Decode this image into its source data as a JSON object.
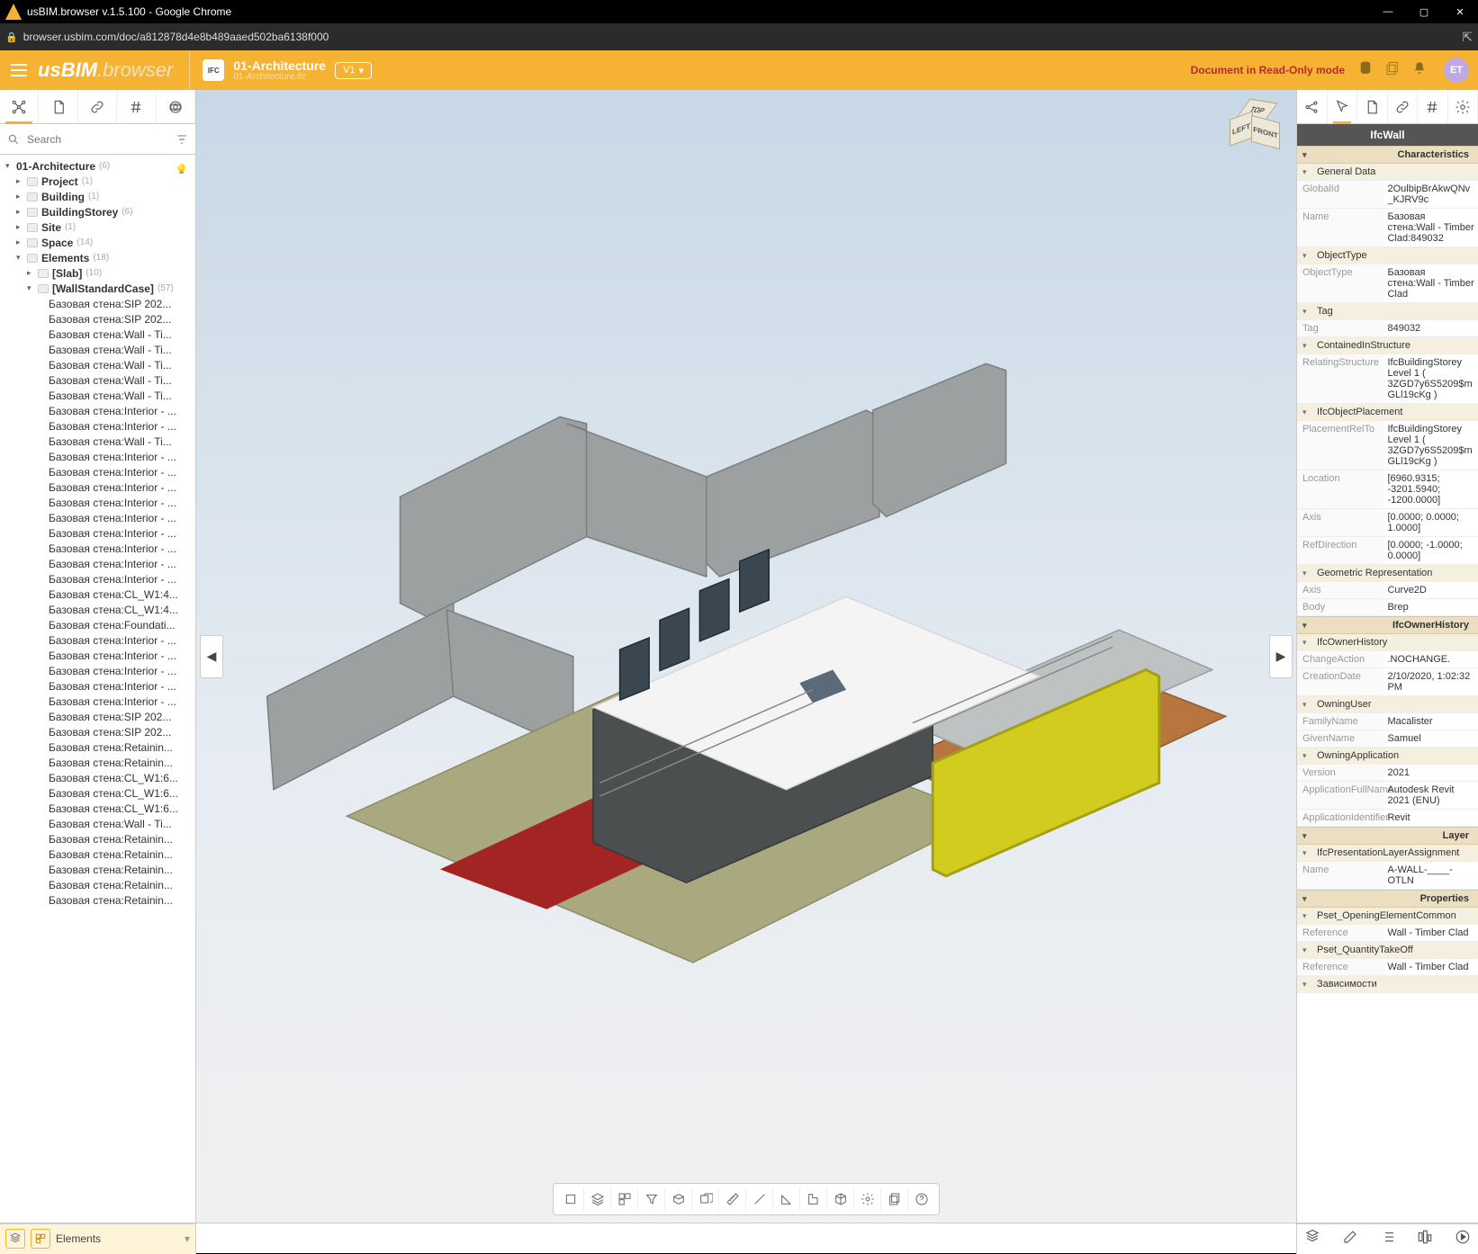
{
  "window": {
    "title": "usBIM.browser v.1.5.100 - Google Chrome",
    "url": "browser.usbim.com/doc/a812878d4e8b489aaed502ba6138f000"
  },
  "brand": {
    "us": "us",
    "bim": "BIM",
    "browser": ".browser"
  },
  "doc": {
    "title": "01-Architecture",
    "file": "01-Architecture.ifc",
    "version": "V1",
    "readonly": "Document in Read-Only mode",
    "avatar": "ET"
  },
  "search": {
    "placeholder": "Search"
  },
  "left_tabs": [
    {
      "name": "structure",
      "active": true
    },
    {
      "name": "documents",
      "active": false
    },
    {
      "name": "links",
      "active": false
    },
    {
      "name": "hash",
      "active": false
    },
    {
      "name": "render",
      "active": false
    }
  ],
  "right_tabs": [
    {
      "name": "share",
      "active": false
    },
    {
      "name": "select",
      "active": true
    },
    {
      "name": "documents",
      "active": false
    },
    {
      "name": "links",
      "active": false
    },
    {
      "name": "hash",
      "active": false
    },
    {
      "name": "settings",
      "active": false
    }
  ],
  "tree": [
    {
      "d": 0,
      "exp": true,
      "fold": false,
      "label": "01-Architecture",
      "count": "(6)",
      "bold": true,
      "bulb": true
    },
    {
      "d": 1,
      "exp": false,
      "fold": true,
      "label": "Project",
      "count": "(1)",
      "bold": true
    },
    {
      "d": 1,
      "exp": false,
      "fold": true,
      "label": "Building",
      "count": "(1)",
      "bold": true
    },
    {
      "d": 1,
      "exp": false,
      "fold": true,
      "label": "BuildingStorey",
      "count": "(6)",
      "bold": true
    },
    {
      "d": 1,
      "exp": false,
      "fold": true,
      "label": "Site",
      "count": "(1)",
      "bold": true
    },
    {
      "d": 1,
      "exp": false,
      "fold": true,
      "label": "Space",
      "count": "(14)",
      "bold": true
    },
    {
      "d": 1,
      "exp": true,
      "fold": true,
      "label": "Elements",
      "count": "(18)",
      "bold": true
    },
    {
      "d": 2,
      "exp": false,
      "fold": true,
      "label": "[Slab]",
      "count": "(10)",
      "bold": true
    },
    {
      "d": 2,
      "exp": true,
      "fold": true,
      "label": "[WallStandardCase]",
      "count": "(57)",
      "bold": true
    },
    {
      "d": 3,
      "label": "Базовая стена:SIP 202..."
    },
    {
      "d": 3,
      "label": "Базовая стена:SIP 202..."
    },
    {
      "d": 3,
      "label": "Базовая стена:Wall - Ti..."
    },
    {
      "d": 3,
      "label": "Базовая стена:Wall - Ti..."
    },
    {
      "d": 3,
      "label": "Базовая стена:Wall - Ti..."
    },
    {
      "d": 3,
      "label": "Базовая стена:Wall - Ti..."
    },
    {
      "d": 3,
      "label": "Базовая стена:Wall - Ti..."
    },
    {
      "d": 3,
      "label": "Базовая стена:Interior - ..."
    },
    {
      "d": 3,
      "label": "Базовая стена:Interior - ..."
    },
    {
      "d": 3,
      "label": "Базовая стена:Wall - Ti..."
    },
    {
      "d": 3,
      "label": "Базовая стена:Interior - ..."
    },
    {
      "d": 3,
      "label": "Базовая стена:Interior - ..."
    },
    {
      "d": 3,
      "label": "Базовая стена:Interior - ..."
    },
    {
      "d": 3,
      "label": "Базовая стена:Interior - ..."
    },
    {
      "d": 3,
      "label": "Базовая стена:Interior - ..."
    },
    {
      "d": 3,
      "label": "Базовая стена:Interior - ..."
    },
    {
      "d": 3,
      "label": "Базовая стена:Interior - ..."
    },
    {
      "d": 3,
      "label": "Базовая стена:Interior - ..."
    },
    {
      "d": 3,
      "label": "Базовая стена:Interior - ..."
    },
    {
      "d": 3,
      "label": "Базовая стена:CL_W1:4..."
    },
    {
      "d": 3,
      "label": "Базовая стена:CL_W1:4..."
    },
    {
      "d": 3,
      "label": "Базовая стена:Foundati..."
    },
    {
      "d": 3,
      "label": "Базовая стена:Interior - ..."
    },
    {
      "d": 3,
      "label": "Базовая стена:Interior - ..."
    },
    {
      "d": 3,
      "label": "Базовая стена:Interior - ..."
    },
    {
      "d": 3,
      "label": "Базовая стена:Interior - ..."
    },
    {
      "d": 3,
      "label": "Базовая стена:Interior - ..."
    },
    {
      "d": 3,
      "label": "Базовая стена:SIP 202..."
    },
    {
      "d": 3,
      "label": "Базовая стена:SIP 202..."
    },
    {
      "d": 3,
      "label": "Базовая стена:Retainin..."
    },
    {
      "d": 3,
      "label": "Базовая стена:Retainin..."
    },
    {
      "d": 3,
      "label": "Базовая стена:CL_W1:6..."
    },
    {
      "d": 3,
      "label": "Базовая стена:CL_W1:6..."
    },
    {
      "d": 3,
      "label": "Базовая стена:CL_W1:6..."
    },
    {
      "d": 3,
      "label": "Базовая стена:Wall - Ti..."
    },
    {
      "d": 3,
      "label": "Базовая стена:Retainin..."
    },
    {
      "d": 3,
      "label": "Базовая стена:Retainin..."
    },
    {
      "d": 3,
      "label": "Базовая стена:Retainin..."
    },
    {
      "d": 3,
      "label": "Базовая стена:Retainin..."
    },
    {
      "d": 3,
      "label": "Базовая стена:Retainin..."
    }
  ],
  "left_bottom": {
    "label": "Elements"
  },
  "viewcube": {
    "top": "TOP",
    "front": "FRONT",
    "left": "LEFT"
  },
  "selected_title": "IfcWall",
  "properties": [
    {
      "type": "bigsec",
      "label": "Characteristics"
    },
    {
      "type": "grp",
      "label": "General Data"
    },
    {
      "type": "kv",
      "k": "GlobalId",
      "v": "2OulbipBrAkwQNv_KJRV9c"
    },
    {
      "type": "kv",
      "k": "Name",
      "v": "Базовая стена:Wall - Timber Clad:849032"
    },
    {
      "type": "grp",
      "label": "ObjectType"
    },
    {
      "type": "kv",
      "k": "ObjectType",
      "v": "Базовая стена:Wall - Timber Clad"
    },
    {
      "type": "grp",
      "label": "Tag"
    },
    {
      "type": "kv",
      "k": "Tag",
      "v": "849032"
    },
    {
      "type": "grp",
      "label": "ContainedInStructure"
    },
    {
      "type": "kv",
      "k": "RelatingStructure",
      "v": "IfcBuildingStorey Level 1 ( 3ZGD7y6S5209$mGLl19cKg )"
    },
    {
      "type": "grp",
      "label": "IfcObjectPlacement"
    },
    {
      "type": "kv",
      "k": "PlacementRelTo",
      "v": "IfcBuildingStorey Level 1 ( 3ZGD7y6S5209$mGLl19cKg )"
    },
    {
      "type": "kv",
      "k": "Location",
      "v": "[6960.9315; -3201.5940; -1200.0000]"
    },
    {
      "type": "kv",
      "k": "Axis",
      "v": "[0.0000; 0.0000; 1.0000]"
    },
    {
      "type": "kv",
      "k": "RefDirection",
      "v": "[0.0000; -1.0000; 0.0000]"
    },
    {
      "type": "grp",
      "label": "Geometric Representation"
    },
    {
      "type": "kv",
      "k": "Axis",
      "v": "Curve2D"
    },
    {
      "type": "kv",
      "k": "Body",
      "v": "Brep"
    },
    {
      "type": "bigsec",
      "label": "IfcOwnerHistory"
    },
    {
      "type": "grp",
      "label": "IfcOwnerHistory"
    },
    {
      "type": "kv",
      "k": "ChangeAction",
      "v": ".NOCHANGE."
    },
    {
      "type": "kv",
      "k": "CreationDate",
      "v": "2/10/2020, 1:02:32 PM"
    },
    {
      "type": "grp",
      "label": "OwningUser"
    },
    {
      "type": "kv",
      "k": "FamilyName",
      "v": "Macalister"
    },
    {
      "type": "kv",
      "k": "GivenName",
      "v": "Samuel"
    },
    {
      "type": "grp",
      "label": "OwningApplication"
    },
    {
      "type": "kv",
      "k": "Version",
      "v": "2021"
    },
    {
      "type": "kv",
      "k": "ApplicationFullName",
      "v": "Autodesk Revit 2021 (ENU)"
    },
    {
      "type": "kv",
      "k": "ApplicationIdentifier",
      "v": "Revit"
    },
    {
      "type": "bigsec",
      "label": "Layer"
    },
    {
      "type": "grp",
      "label": "IfcPresentationLayerAssignment"
    },
    {
      "type": "kv",
      "k": "Name",
      "v": "A-WALL-____-OTLN"
    },
    {
      "type": "bigsec",
      "label": "Properties"
    },
    {
      "type": "grp",
      "label": "Pset_OpeningElementCommon"
    },
    {
      "type": "kv",
      "k": "Reference",
      "v": "Wall - Timber Clad"
    },
    {
      "type": "grp",
      "label": "Pset_QuantityTakeOff"
    },
    {
      "type": "kv",
      "k": "Reference",
      "v": "Wall - Timber Clad"
    },
    {
      "type": "grp",
      "label": "Зависимости"
    }
  ],
  "bottom_toolbar": [
    "select-mode",
    "layers",
    "groups",
    "filter",
    "clip-top",
    "clip-front",
    "measure",
    "line",
    "angle",
    "area",
    "cube",
    "gear",
    "copy",
    "help"
  ],
  "right_bottom_tools": [
    "ifc",
    "edit",
    "list",
    "timeline",
    "run"
  ]
}
